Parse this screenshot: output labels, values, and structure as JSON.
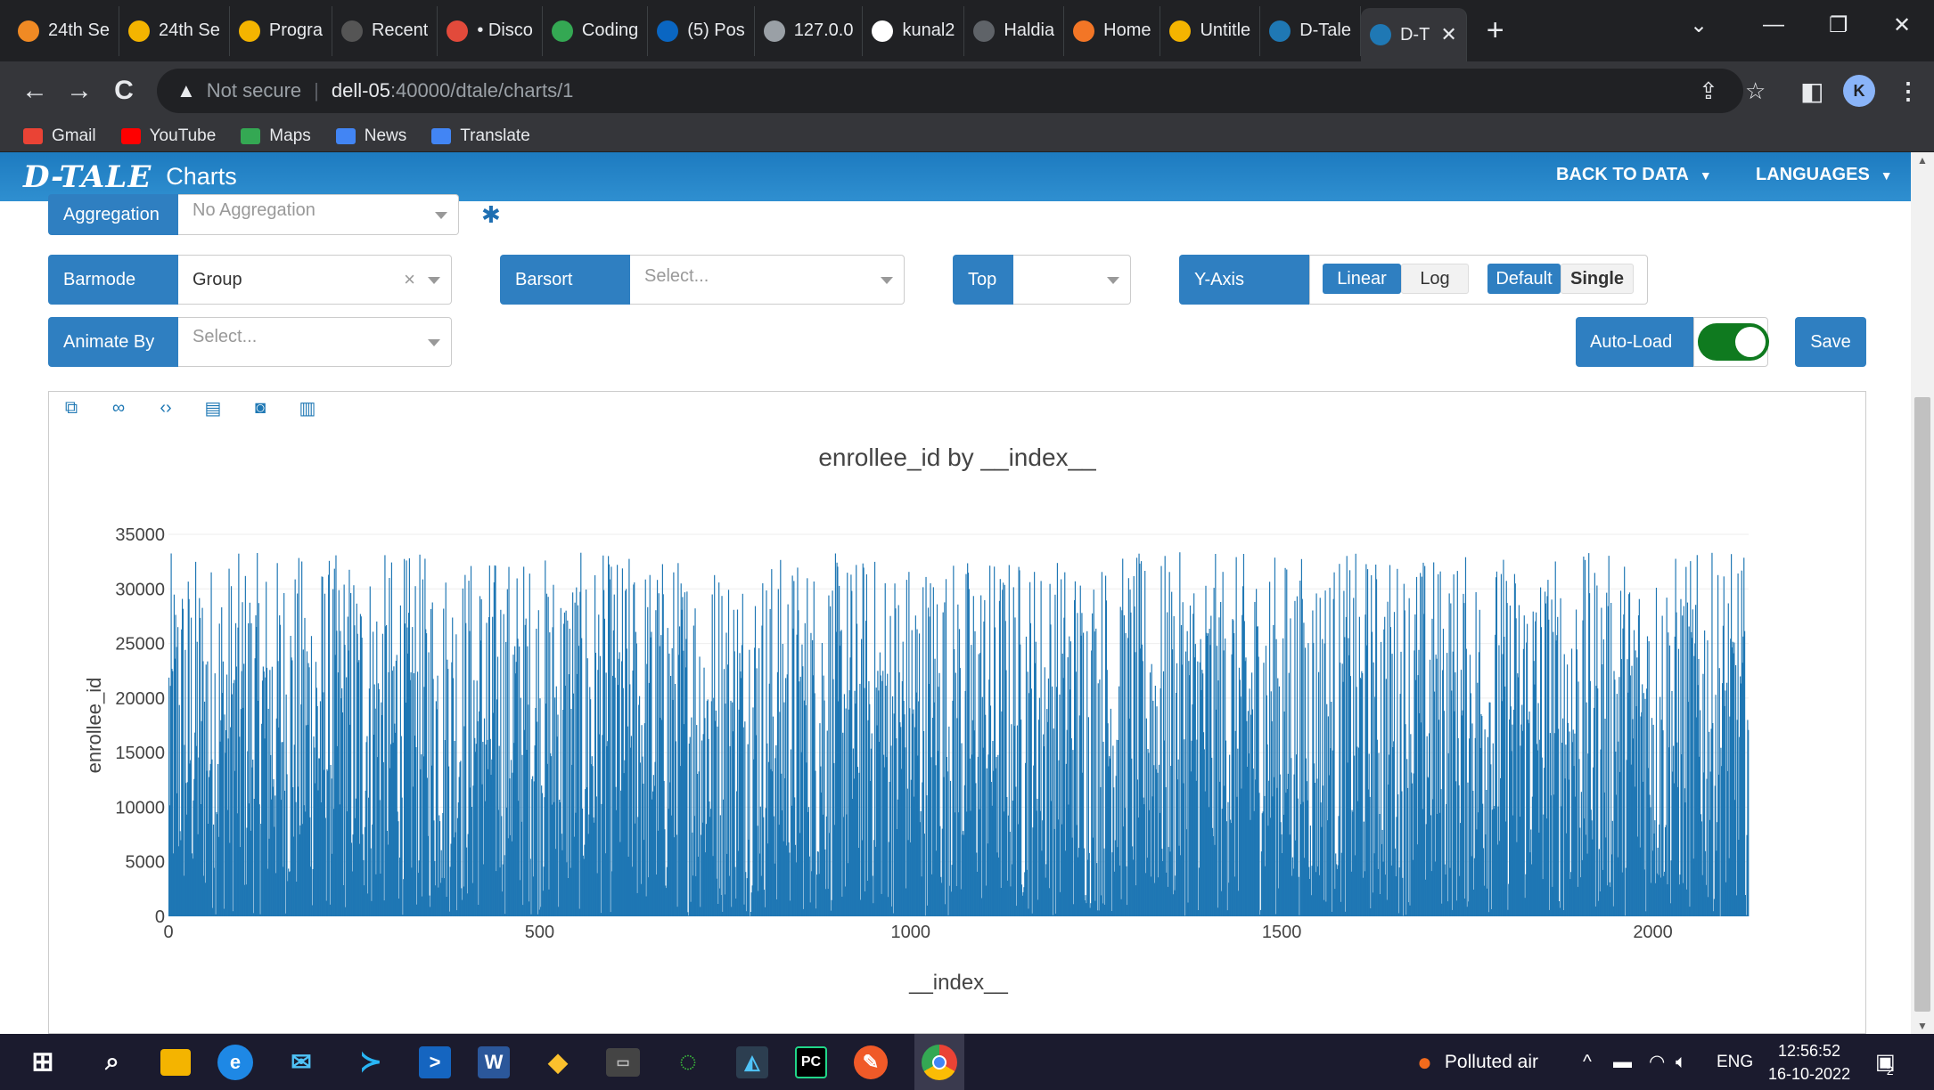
{
  "browser": {
    "tabs": [
      {
        "title": "24th Se",
        "icon": "circle-orange-icon",
        "color": "#f08a24"
      },
      {
        "title": "24th Se",
        "icon": "drive-icon",
        "color": "#f4b400"
      },
      {
        "title": "Progra",
        "icon": "drive-icon",
        "color": "#f4b400"
      },
      {
        "title": "Recent",
        "icon": "cc-icon",
        "color": "#555555"
      },
      {
        "title": "• Disco",
        "icon": "discord-icon",
        "color": "#e24a3b"
      },
      {
        "title": "Coding",
        "icon": "check-circle-icon",
        "color": "#34a853"
      },
      {
        "title": "(5) Pos",
        "icon": "linkedin-icon",
        "color": "#0a66c2"
      },
      {
        "title": "127.0.0",
        "icon": "globe-icon",
        "color": "#9aa0a6"
      },
      {
        "title": "kunal2",
        "icon": "github-icon",
        "color": "#ffffff"
      },
      {
        "title": "Haldia",
        "icon": "stream-icon",
        "color": "#5f6368"
      },
      {
        "title": "Home",
        "icon": "jupyter-icon",
        "color": "#f37626"
      },
      {
        "title": "Untitle",
        "icon": "notebook-icon",
        "color": "#f4b400"
      },
      {
        "title": "D-Tale",
        "icon": "search-icon",
        "color": "#1f78b4"
      },
      {
        "title": "D-T",
        "icon": "search-icon",
        "color": "#1f78b4"
      }
    ],
    "url_warning": "Not secure",
    "url_host": "dell-05",
    "url_rest": ":40000/dtale/charts/1",
    "profile_initial": "K",
    "bookmarks": [
      {
        "label": "Gmail",
        "color": "#ea4335"
      },
      {
        "label": "YouTube",
        "color": "#ff0000"
      },
      {
        "label": "Maps",
        "color": "#34a853"
      },
      {
        "label": "News",
        "color": "#4285f4"
      },
      {
        "label": "Translate",
        "color": "#4285f4"
      }
    ]
  },
  "app": {
    "logo": "D-TALE",
    "title": "Charts",
    "back_to_data": "BACK TO DATA",
    "languages": "LANGUAGES"
  },
  "controls": {
    "aggregation_label": "Aggregation",
    "aggregation_value": "No Aggregation",
    "barmode_label": "Barmode",
    "barmode_value": "Group",
    "barsort_label": "Barsort",
    "barsort_placeholder": "Select...",
    "top_label": "Top",
    "top_value": "",
    "yaxis_label": "Y-Axis",
    "yaxis_linear": "Linear",
    "yaxis_log": "Log",
    "yaxis_default": "Default",
    "yaxis_single": "Single",
    "animate_label": "Animate By",
    "animate_placeholder": "Select...",
    "autoload_label": "Auto-Load",
    "autoload_on": true,
    "save_label": "Save"
  },
  "chart_data": {
    "type": "bar",
    "title": "enrollee_id by __index__",
    "xlabel": "__index__",
    "ylabel": "enrollee_id",
    "xlim": [
      0,
      2129
    ],
    "ylim": [
      0,
      35000
    ],
    "xticks": [
      0,
      500,
      1000,
      1500,
      2000
    ],
    "yticks": [
      0,
      5000,
      10000,
      15000,
      20000,
      25000,
      30000,
      35000
    ],
    "n_bars": 2129,
    "value_max": 33380,
    "value_min": 3,
    "bar_color": "#1f77b4",
    "grid": true
  },
  "taskbar": {
    "weather": "Polluted air",
    "lang": "ENG",
    "time": "12:56:52",
    "date": "16-10-2022",
    "notifications": "2"
  }
}
